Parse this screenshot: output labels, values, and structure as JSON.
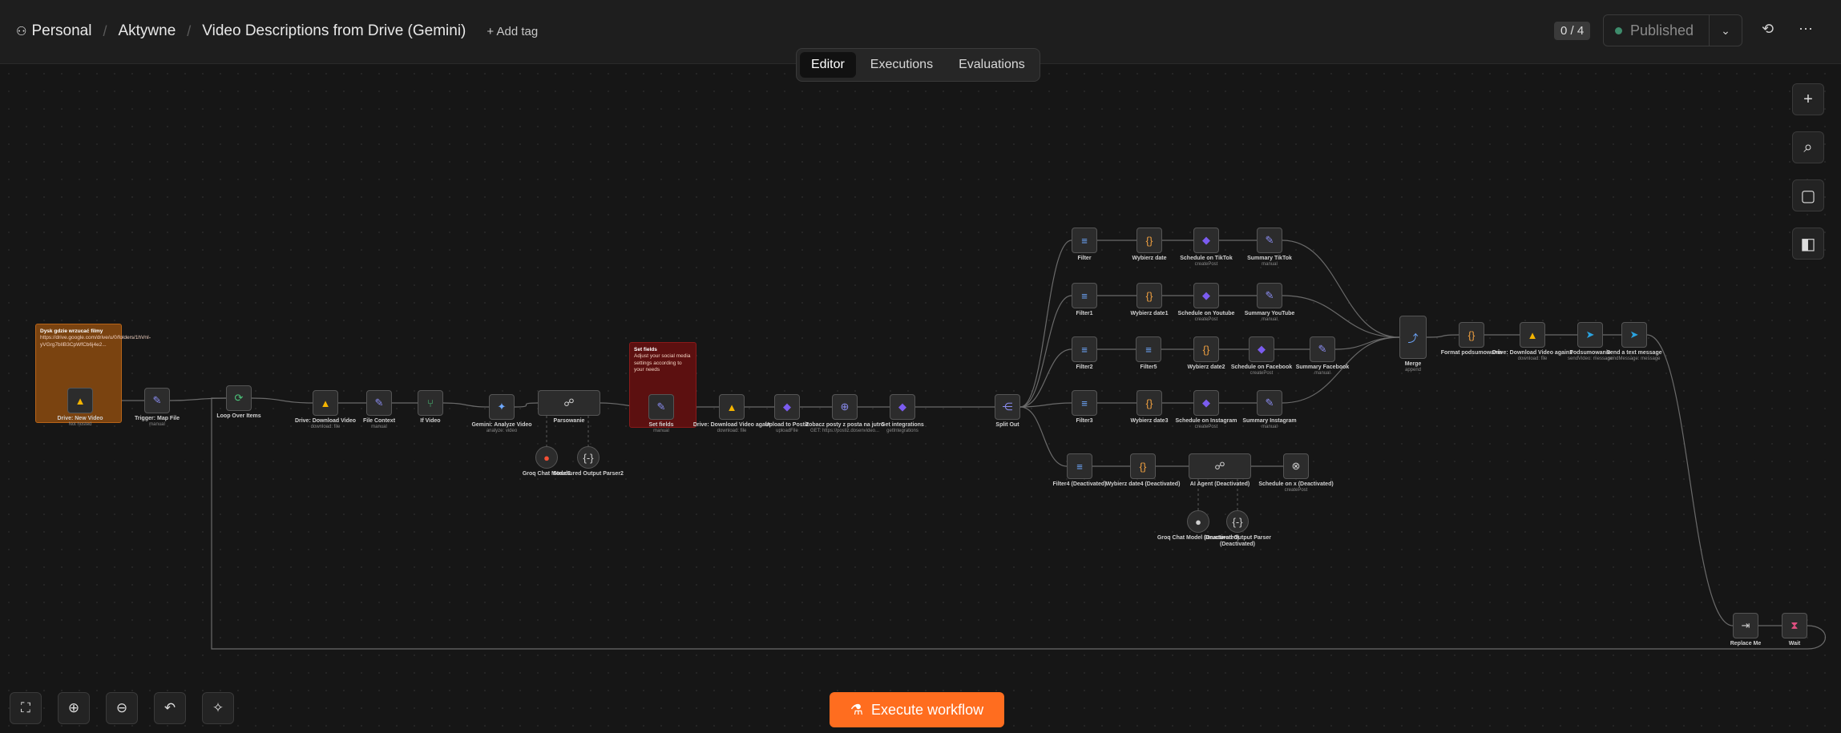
{
  "header": {
    "breadcrumb": [
      "Personal",
      "Aktywne",
      "Video Descriptions from Drive (Gemini)"
    ],
    "add_tag": "+ Add tag",
    "counter": "0 / 4",
    "published": "Published"
  },
  "tabs": [
    "Editor",
    "Executions",
    "Evaluations"
  ],
  "sticky_notes": [
    {
      "title": "Dysk gdzie wrzucać filmy",
      "text": "https://drive.google.com/drive/u/0/folders/1hVnI-yVGrg7bIlB3CpWfCb6j4e2...",
      "color": "#7a4310",
      "border": "#b86418"
    },
    {
      "title": "Set fields",
      "text": "Adjust your social media settings according to your needs",
      "color": "#5c1010",
      "border": "#8a1a1a"
    }
  ],
  "nodes": [
    {
      "label": "Drive: New Video",
      "sub": "Not hosted",
      "icon": "google-drive-icon",
      "glyph": "▲",
      "color": "#f4b400"
    },
    {
      "label": "Trigger: Map File",
      "sub": "manual",
      "icon": "pencil-icon",
      "glyph": "✎",
      "color": "#8a8cf0"
    },
    {
      "label": "Loop Over Items",
      "sub": "",
      "icon": "loop-icon",
      "glyph": "⟳",
      "color": "#4cc47a"
    },
    {
      "label": "Drive: Download Video",
      "sub": "download: file",
      "icon": "google-drive-icon",
      "glyph": "▲",
      "color": "#f4b400"
    },
    {
      "label": "File Context",
      "sub": "manual",
      "icon": "pencil-icon",
      "glyph": "✎",
      "color": "#8a8cf0"
    },
    {
      "label": "If Video",
      "sub": "",
      "icon": "if-icon",
      "glyph": "⑂",
      "color": "#4cc47a"
    },
    {
      "label": "Gemini: Analyze Video",
      "sub": "analyze: video",
      "icon": "gemini-icon",
      "glyph": "✦",
      "color": "#6ea8ff"
    },
    {
      "label": "Parsowanie",
      "sub": "",
      "icon": "ai-agent-icon",
      "glyph": "☍",
      "color": "#d0d0d0"
    },
    {
      "label": "Groq Chat Model2",
      "sub": "",
      "icon": "groq-icon",
      "glyph": "●",
      "color": "#f55036"
    },
    {
      "label": "Structured Output Parser2",
      "sub": "",
      "icon": "parser-icon",
      "glyph": "{-}",
      "color": "#d0d0d0"
    },
    {
      "label": "Set fields",
      "sub": "manual",
      "icon": "pencil-icon",
      "glyph": "✎",
      "color": "#8a8cf0"
    },
    {
      "label": "Drive: Download Video again",
      "sub": "download: file",
      "icon": "google-drive-icon",
      "glyph": "▲",
      "color": "#f4b400"
    },
    {
      "label": "Upload to Postiz",
      "sub": "uploadFile",
      "icon": "postiz-icon",
      "glyph": "◆",
      "color": "#7b5cf0"
    },
    {
      "label": "Zobacz posty z posta na jutro",
      "sub": "GET: https://postiz.dosenvideo...",
      "icon": "globe-icon",
      "glyph": "⊕",
      "color": "#8a8cf0"
    },
    {
      "label": "Get integrations",
      "sub": "getIntegrations",
      "icon": "postiz-icon",
      "glyph": "◆",
      "color": "#7b5cf0"
    },
    {
      "label": "Split Out",
      "sub": "",
      "icon": "split-icon",
      "glyph": "⋲",
      "color": "#8a8cf0"
    },
    {
      "label": "Filter",
      "sub": "",
      "icon": "filter-icon",
      "glyph": "≡",
      "color": "#6ea8ff"
    },
    {
      "label": "Wybierz date",
      "sub": "",
      "icon": "code-icon",
      "glyph": "{}",
      "color": "#f0a040"
    },
    {
      "label": "Schedule on TikTok",
      "sub": "createPost",
      "icon": "postiz-icon",
      "glyph": "◆",
      "color": "#7b5cf0"
    },
    {
      "label": "Summary TikTok",
      "sub": "manual",
      "icon": "pencil-icon",
      "glyph": "✎",
      "color": "#8a8cf0"
    },
    {
      "label": "Filter1",
      "sub": "",
      "icon": "filter-icon",
      "glyph": "≡",
      "color": "#6ea8ff"
    },
    {
      "label": "Wybierz date1",
      "sub": "",
      "icon": "code-icon",
      "glyph": "{}",
      "color": "#f0a040"
    },
    {
      "label": "Schedule on Youtube",
      "sub": "createPost",
      "icon": "postiz-icon",
      "glyph": "◆",
      "color": "#7b5cf0"
    },
    {
      "label": "Summary YouTube",
      "sub": "manual",
      "icon": "pencil-icon",
      "glyph": "✎",
      "color": "#8a8cf0"
    },
    {
      "label": "Filter2",
      "sub": "",
      "icon": "filter-icon",
      "glyph": "≡",
      "color": "#6ea8ff"
    },
    {
      "label": "Filter5",
      "sub": "",
      "icon": "filter-icon",
      "glyph": "≡",
      "color": "#6ea8ff"
    },
    {
      "label": "Wybierz date2",
      "sub": "",
      "icon": "code-icon",
      "glyph": "{}",
      "color": "#f0a040"
    },
    {
      "label": "Schedule on Facebook",
      "sub": "createPost",
      "icon": "postiz-icon",
      "glyph": "◆",
      "color": "#7b5cf0"
    },
    {
      "label": "Summary Facebook",
      "sub": "manual",
      "icon": "pencil-icon",
      "glyph": "✎",
      "color": "#8a8cf0"
    },
    {
      "label": "Filter3",
      "sub": "",
      "icon": "filter-icon",
      "glyph": "≡",
      "color": "#6ea8ff"
    },
    {
      "label": "Wybierz date3",
      "sub": "",
      "icon": "code-icon",
      "glyph": "{}",
      "color": "#f0a040"
    },
    {
      "label": "Schedule on Instagram",
      "sub": "createPost",
      "icon": "postiz-icon",
      "glyph": "◆",
      "color": "#7b5cf0"
    },
    {
      "label": "Summary Instagram",
      "sub": "manual",
      "icon": "pencil-icon",
      "glyph": "✎",
      "color": "#8a8cf0"
    },
    {
      "label": "Filter4 (Deactivated)",
      "sub": "",
      "icon": "filter-icon",
      "glyph": "≡",
      "color": "#6ea8ff"
    },
    {
      "label": "Wybierz date4 (Deactivated)",
      "sub": "",
      "icon": "code-icon",
      "glyph": "{}",
      "color": "#f0a040"
    },
    {
      "label": "AI Agent (Deactivated)",
      "sub": "",
      "icon": "ai-agent-icon",
      "glyph": "☍",
      "color": "#d0d0d0"
    },
    {
      "label": "Schedule on x (Deactivated)",
      "sub": "createPost",
      "icon": "x-icon",
      "glyph": "⊗",
      "color": "#d0d0d0"
    },
    {
      "label": "Groq Chat Model (Deactivated)",
      "sub": "",
      "icon": "groq-icon",
      "glyph": "●",
      "color": "#d0d0d0"
    },
    {
      "label": "Structured Output Parser (Deactivated)",
      "sub": "",
      "icon": "parser-icon",
      "glyph": "{-}",
      "color": "#d0d0d0"
    },
    {
      "label": "Merge",
      "sub": "append",
      "icon": "merge-icon",
      "glyph": "⤴",
      "color": "#6ea8ff"
    },
    {
      "label": "Format podsumowania",
      "sub": "",
      "icon": "code-icon",
      "glyph": "{}",
      "color": "#f0a040"
    },
    {
      "label": "Drive: Download Video again1",
      "sub": "download: file",
      "icon": "google-drive-icon",
      "glyph": "▲",
      "color": "#f4b400"
    },
    {
      "label": "Podsumowanie",
      "sub": "sendVideo: message",
      "icon": "telegram-icon",
      "glyph": "➤",
      "color": "#2aa3e0"
    },
    {
      "label": "Send a text message",
      "sub": "sendMessage: message",
      "icon": "telegram-icon",
      "glyph": "➤",
      "color": "#2aa3e0"
    },
    {
      "label": "Replace Me",
      "sub": "",
      "icon": "replace-icon",
      "glyph": "⇥",
      "color": "#d0d0d0"
    },
    {
      "label": "Wait",
      "sub": "",
      "icon": "hourglass-icon",
      "glyph": "⧗",
      "color": "#e05080"
    }
  ],
  "execute_label": "Execute workflow"
}
